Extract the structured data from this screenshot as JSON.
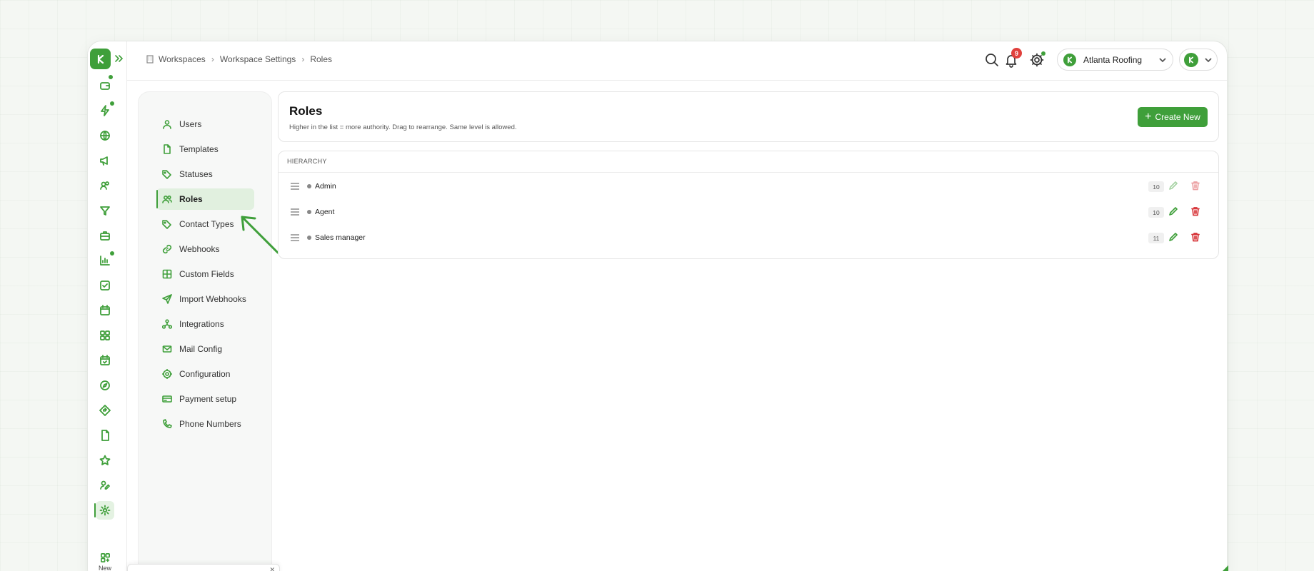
{
  "breadcrumb": {
    "items": [
      "Workspaces",
      "Workspace Settings",
      "Roles"
    ]
  },
  "header": {
    "notification_count": "9",
    "workspace_name": "Atlanta Roofing"
  },
  "settings_nav": {
    "items": [
      {
        "label": "Users",
        "icon": "user-icon"
      },
      {
        "label": "Templates",
        "icon": "file-icon"
      },
      {
        "label": "Statuses",
        "icon": "tag-icon"
      },
      {
        "label": "Roles",
        "icon": "users-icon",
        "active": true
      },
      {
        "label": "Contact Types",
        "icon": "tag-icon"
      },
      {
        "label": "Webhooks",
        "icon": "link-icon"
      },
      {
        "label": "Custom Fields",
        "icon": "grid-icon"
      },
      {
        "label": "Import Webhooks",
        "icon": "send-icon"
      },
      {
        "label": "Integrations",
        "icon": "network-icon"
      },
      {
        "label": "Mail Config",
        "icon": "mail-icon"
      },
      {
        "label": "Configuration",
        "icon": "gear-icon"
      },
      {
        "label": "Payment setup",
        "icon": "card-icon"
      },
      {
        "label": "Phone Numbers",
        "icon": "phone-icon"
      }
    ]
  },
  "roles": {
    "title": "Roles",
    "subtitle": "Higher in the list = more authority. Drag to rearrange. Same level is allowed.",
    "create_label": "Create New",
    "hierarchy_label": "HIERARCHY",
    "rows": [
      {
        "name": "Admin",
        "level": "10",
        "actions_disabled": true
      },
      {
        "name": "Agent",
        "level": "10",
        "actions_disabled": false
      },
      {
        "name": "Sales manager",
        "level": "11",
        "actions_disabled": false
      }
    ]
  },
  "rail": {
    "new_label": "New"
  },
  "colors": {
    "accent": "#3f9f3a",
    "danger": "#d7363a",
    "badge": "#e0403c"
  }
}
